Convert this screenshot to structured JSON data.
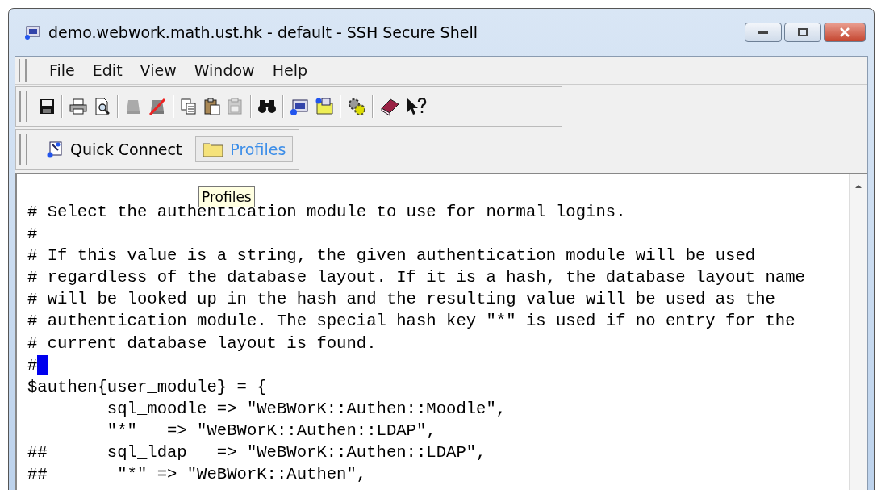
{
  "window": {
    "title": "demo.webwork.math.ust.hk - default - SSH Secure Shell"
  },
  "menu": [
    "File",
    "Edit",
    "View",
    "Window",
    "Help"
  ],
  "quick_bar": [
    {
      "kind": "connect",
      "label": "Quick Connect",
      "highlighted": false
    },
    {
      "kind": "folder",
      "label": "Profiles",
      "highlighted": true
    }
  ],
  "tooltip": "Profiles",
  "terminal": {
    "lines": [
      {
        "text": "# Select the authentication module to use for normal logins.",
        "cursor": false
      },
      {
        "text": "#",
        "cursor": false
      },
      {
        "text": "# If this value is a string, the given authentication module will be used",
        "cursor": false
      },
      {
        "text": "# regardless of the database layout. If it is a hash, the database layout name",
        "cursor": false
      },
      {
        "text": "# will be looked up in the hash and the resulting value will be used as the",
        "cursor": false
      },
      {
        "text": "# authentication module. The special hash key \"*\" is used if no entry for the",
        "cursor": false
      },
      {
        "text": "# current database layout is found.",
        "cursor": false
      },
      {
        "text": "#",
        "cursor": true
      },
      {
        "text": "$authen{user_module} = {",
        "cursor": false
      },
      {
        "text": "        sql_moodle => \"WeBWorK::Authen::Moodle\",",
        "cursor": false
      },
      {
        "text": "        \"*\"   => \"WeBWorK::Authen::LDAP\",",
        "cursor": false
      },
      {
        "text": "##      sql_ldap   => \"WeBWorK::Authen::LDAP\",",
        "cursor": false
      },
      {
        "text": "##       \"*\" => \"WeBWorK::Authen\",",
        "cursor": false
      }
    ]
  }
}
